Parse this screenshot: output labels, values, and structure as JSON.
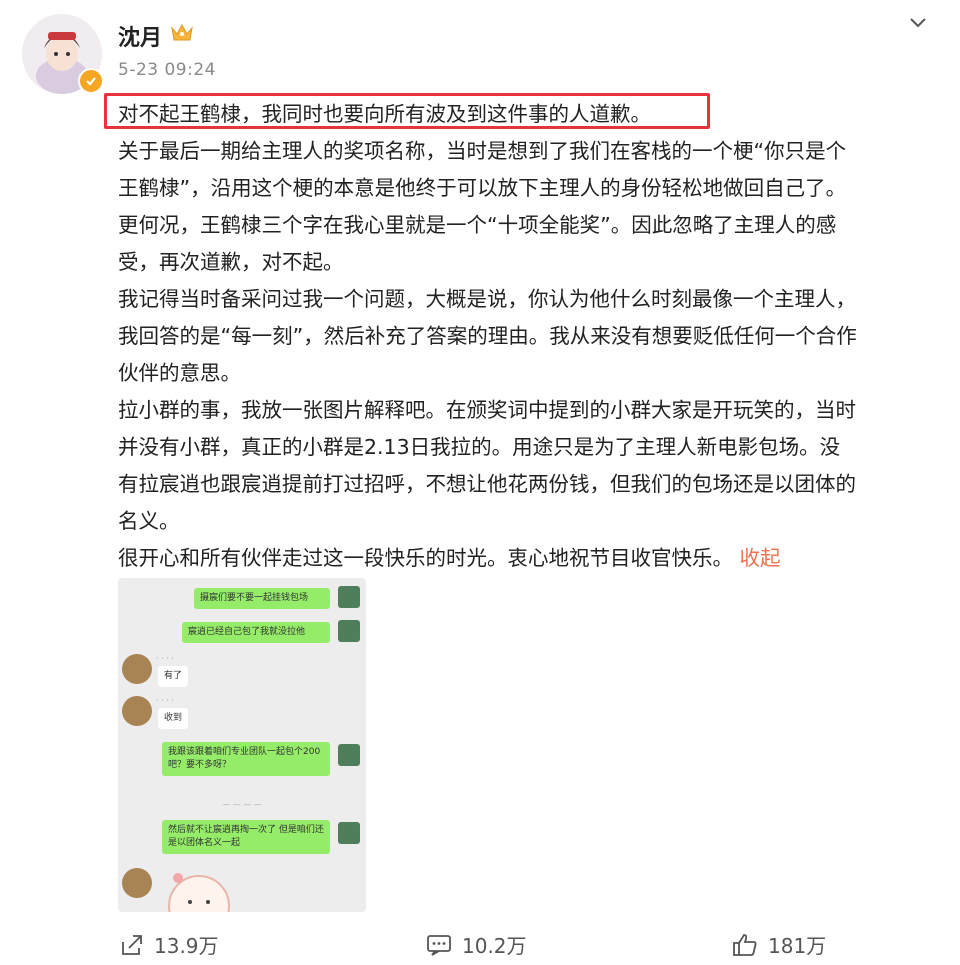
{
  "header": {
    "username": "沈月",
    "timestamp": "5-23 09:24"
  },
  "post": {
    "lines": [
      "对不起王鹤棣，我同时也要向所有波及到这件事的人道歉。",
      "关于最后一期给主理人的奖项名称，当时是想到了我们在客栈的一个梗“你只是个",
      "王鹤棣”，沿用这个梗的本意是他终于可以放下主理人的身份轻松地做回自己了。",
      "更何况，王鹤棣三个字在我心里就是一个“十项全能奖”。因此忽略了主理人的感",
      "受，再次道歉，对不起。",
      "我记得当时备采问过我一个问题，大概是说，你认为他什么时刻最像一个主理人，",
      "我回答的是“每一刻”，然后补充了答案的理由。我从来没有想要贬低任何一个合作",
      "伙伴的意思。",
      "拉小群的事，我放一张图片解释吧。在颁奖词中提到的小群大家是开玩笑的，当时",
      "并没有小群，真正的小群是2.13日我拉的。用途只是为了主理人新电影包场。没",
      "有拉宸逍也跟宸逍提前打过招呼，不想让他花两份钱，但我们的包场还是以团体的",
      "名义。",
      "很开心和所有伙伴走过这一段快乐的时光。衷心地祝节目收官快乐。"
    ],
    "collapse_label": "收起"
  },
  "chat": {
    "messages": [
      "摄宸们要不要一起挂钱包场",
      "宸逍已经自己包了我就没拉他",
      "有了",
      "收到",
      "我跟该跟着咱们专业团队一起包个200吧？要不多呀？",
      "然后就不让宸逍再掏一次了 但是咱们还是以团体名义一起"
    ]
  },
  "actions": {
    "share": "13.9万",
    "comment": "10.2万",
    "like": "181万"
  },
  "colors": {
    "highlight_border": "#e8323c",
    "link": "#eb7350",
    "verified": "#f5a623",
    "chat_bubble": "#95ec69"
  }
}
